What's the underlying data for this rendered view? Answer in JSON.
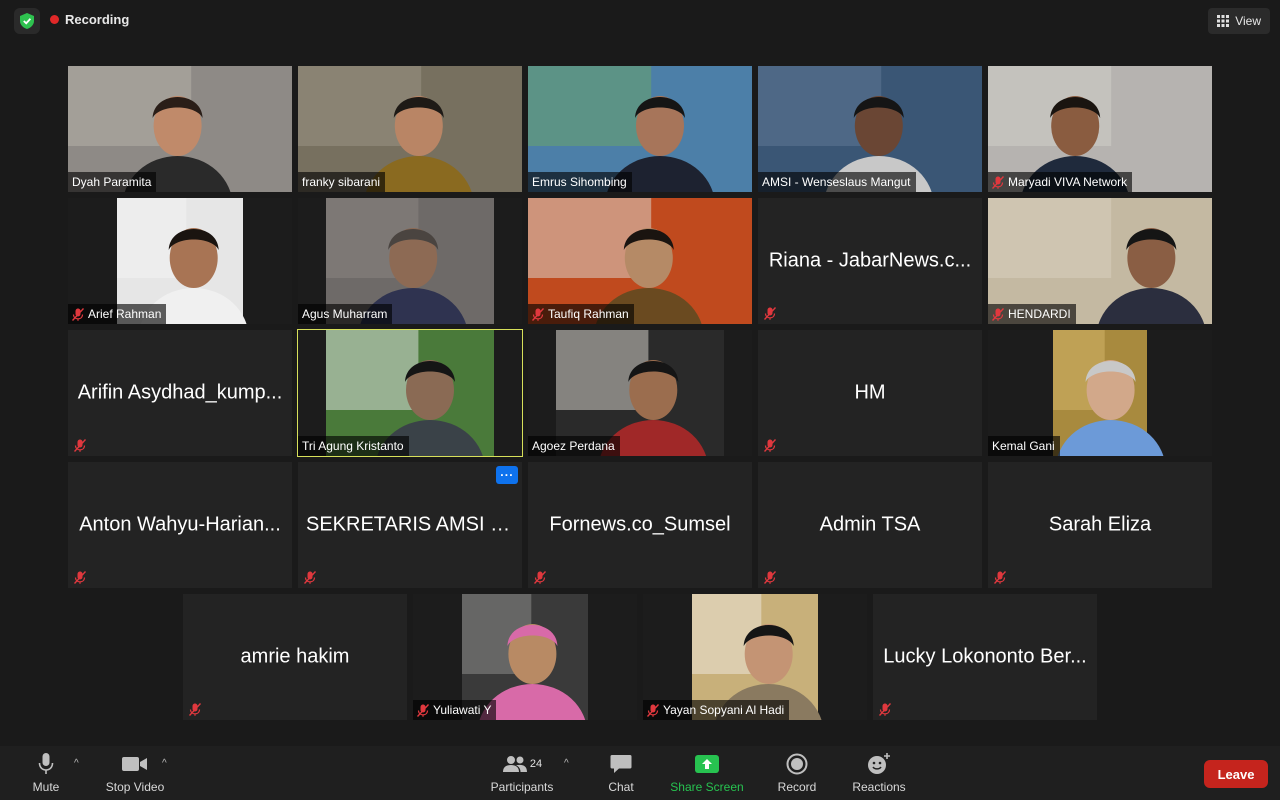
{
  "topbar": {
    "recording_label": "Recording",
    "view_label": "View"
  },
  "participants": [
    {
      "id": "dyah",
      "name": "Dyah Paramita",
      "video": true,
      "muted": false
    },
    {
      "id": "franky",
      "name": "franky sibarani",
      "video": true,
      "muted": false
    },
    {
      "id": "emrus",
      "name": "Emrus Sihombing",
      "video": true,
      "muted": false
    },
    {
      "id": "amsi",
      "name": "AMSI - Wenseslaus Mangut",
      "video": true,
      "muted": false
    },
    {
      "id": "maryadi",
      "name": "Maryadi VIVA Network",
      "video": true,
      "muted": true
    },
    {
      "id": "arief",
      "name": "Arief Rahman",
      "video": true,
      "muted": true
    },
    {
      "id": "agus",
      "name": "Agus Muharram",
      "video": true,
      "muted": false
    },
    {
      "id": "taufiq",
      "name": "Taufiq Rahman",
      "video": true,
      "muted": true
    },
    {
      "id": "riana",
      "name": "Riana - JabarNews.c...",
      "video": false,
      "muted": true
    },
    {
      "id": "hendardi",
      "name": "HENDARDI",
      "video": true,
      "muted": true
    },
    {
      "id": "arifin",
      "name": "Arifin Asydhad_kump...",
      "video": false,
      "muted": true
    },
    {
      "id": "tri",
      "name": "Tri Agung Kristanto",
      "video": true,
      "muted": false
    },
    {
      "id": "agoez",
      "name": "Agoez Perdana",
      "video": true,
      "muted": false
    },
    {
      "id": "hm",
      "name": "HM",
      "video": false,
      "muted": true
    },
    {
      "id": "kemal",
      "name": "Kemal Gani",
      "video": true,
      "muted": false
    },
    {
      "id": "anton",
      "name": "Anton Wahyu-Harian...",
      "video": false,
      "muted": true
    },
    {
      "id": "sekretaris",
      "name": "SEKRETARIS AMSI K...",
      "video": false,
      "muted": true
    },
    {
      "id": "fornews",
      "name": "Fornews.co_Sumsel",
      "video": false,
      "muted": true
    },
    {
      "id": "admin",
      "name": "Admin TSA",
      "video": false,
      "muted": true
    },
    {
      "id": "sarah",
      "name": "Sarah Eliza",
      "video": false,
      "muted": true
    },
    {
      "id": "amrie",
      "name": "amrie hakim",
      "video": false,
      "muted": true
    },
    {
      "id": "yuliawati",
      "name": "Yuliawati Y",
      "video": true,
      "muted": true
    },
    {
      "id": "yayan",
      "name": "Yayan Sopyani Al Hadi",
      "video": true,
      "muted": true
    },
    {
      "id": "lucky",
      "name": "Lucky Lokononto Ber...",
      "video": false,
      "muted": true
    }
  ],
  "more_button_label": "···",
  "toolbar": {
    "mute_label": "Mute",
    "stop_video_label": "Stop Video",
    "participants_label": "Participants",
    "participants_count": "24",
    "chat_label": "Chat",
    "share_screen_label": "Share Screen",
    "record_label": "Record",
    "reactions_label": "Reactions",
    "leave_label": "Leave"
  },
  "colors": {
    "active_speaker": "#d7e05a",
    "leave": "#c5241d",
    "share": "#27c250",
    "accent": "#0e72ed"
  }
}
